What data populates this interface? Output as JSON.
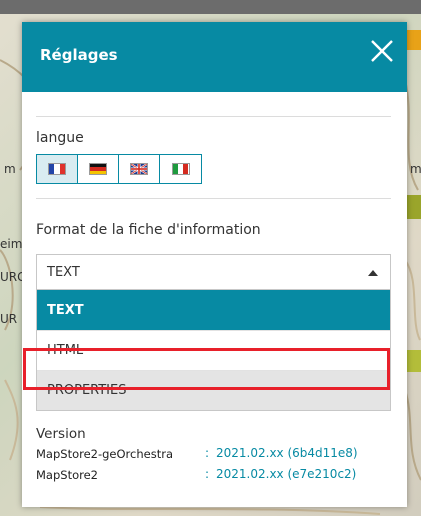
{
  "map": {
    "labels": [
      "m",
      "eim",
      "URG",
      "UR",
      "m"
    ]
  },
  "dialog": {
    "title": "Réglages",
    "close_icon": "close-icon"
  },
  "language": {
    "label": "langue",
    "options": [
      {
        "code": "fr",
        "icon": "flag-france-icon",
        "selected": true
      },
      {
        "code": "de",
        "icon": "flag-germany-icon",
        "selected": false
      },
      {
        "code": "en",
        "icon": "flag-uk-icon",
        "selected": false
      },
      {
        "code": "it",
        "icon": "flag-italy-icon",
        "selected": false
      }
    ]
  },
  "info_format": {
    "label": "Format de la fiche d'information",
    "selected_value": "TEXT",
    "options": [
      "TEXT",
      "HTML",
      "PROPERTIES"
    ],
    "highlighted_option": "PROPERTIES"
  },
  "version": {
    "title": "Version",
    "rows": [
      {
        "name": "MapStore2-geOrchestra",
        "separator": ":",
        "value": "2021.02.xx (6b4d11e8)"
      },
      {
        "name": "MapStore2",
        "separator": ":",
        "value": "2021.02.xx (e7e210c2)"
      }
    ]
  },
  "colors": {
    "accent": "#078aa3",
    "highlight_border": "#e8202a"
  }
}
